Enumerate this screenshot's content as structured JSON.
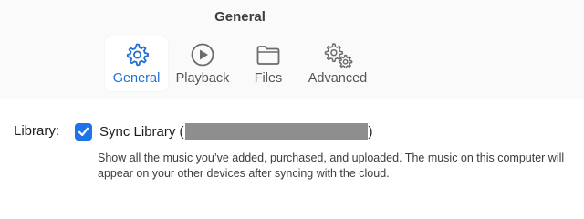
{
  "window": {
    "title": "General"
  },
  "toolbar": {
    "tabs": [
      {
        "label": "General",
        "icon": "gear-icon",
        "active": true
      },
      {
        "label": "Playback",
        "icon": "play-circle-icon",
        "active": false
      },
      {
        "label": "Files",
        "icon": "folder-icon",
        "active": false
      },
      {
        "label": "Advanced",
        "icon": "gears-icon",
        "active": false
      }
    ]
  },
  "library": {
    "label": "Library:",
    "checkbox_checked": true,
    "sync_prefix": "Sync Library (",
    "sync_suffix": ")",
    "description": "Show all the music you’ve added, purchased, and uploaded. The music on this computer will appear on your other devices after syncing with the cloud."
  },
  "colors": {
    "accent": "#1b74e8",
    "active_tab_text": "#1f6fd6",
    "redaction": "#8e8e8e"
  }
}
